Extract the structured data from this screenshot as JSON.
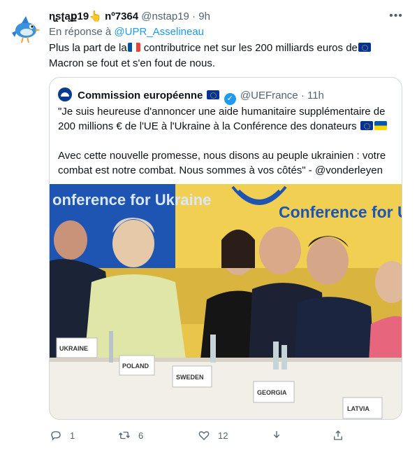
{
  "tweet": {
    "author_name": "ɳʂʈąք19👆 nº7364",
    "author_handle": "@nstap19",
    "separator": "·",
    "time": "9h",
    "reply_prefix": "En réponse à",
    "reply_handle": "@UPR_Asselineau",
    "text_part1": "Plus la part de la",
    "text_part2": " contributrice net sur les 200 milliards euros de",
    "text_part3": "Macron se fout et s'en fout de nous."
  },
  "quoted": {
    "author_name": "Commission européenne",
    "author_handle": "@UEFrance",
    "separator": "·",
    "time": "11h",
    "paragraph1": "\"Je suis heureuse d'annoncer une aide humanitaire supplémentaire de 200 millions € de l'UE à l'Ukraine à la Conférence des donateurs",
    "paragraph2": "Avec cette nouvelle promesse, nous disons au peuple ukrainien : votre combat est notre combat. Nous sommes à vos côtés\" - @vonderleyen",
    "image": {
      "banner_left": "onference for Ukraine",
      "banner_right": "Conference for Ukrain",
      "place_cards": [
        "UKRAINE",
        "POLAND",
        "SWEDEN",
        "GEORGIA",
        "LATVIA"
      ]
    }
  },
  "actions": {
    "reply_count": "1",
    "retweet_count": "6",
    "like_count": "12"
  },
  "colors": {
    "link": "#1d9bf0",
    "secondary_text": "#536471",
    "border": "#cfd9de",
    "banner_yellow": "#e9c64a",
    "banner_blue": "#1e55b3"
  },
  "icons": [
    "bird-avatar-icon",
    "more-icon",
    "verified-icon",
    "reply-icon",
    "retweet-icon",
    "like-icon",
    "share-icon",
    "download-icon"
  ]
}
